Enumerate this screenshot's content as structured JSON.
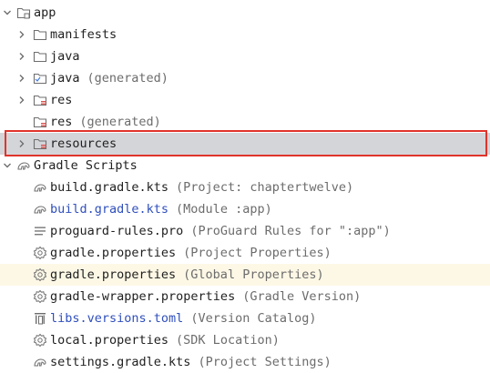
{
  "tree": {
    "app": {
      "label": "app",
      "icon": "module-folder-icon"
    },
    "manifests": {
      "label": "manifests",
      "icon": "folder-icon"
    },
    "java": {
      "label": "java",
      "icon": "folder-icon"
    },
    "java_generated": {
      "label": "java",
      "hint": "(generated)",
      "icon": "generated-source-folder-icon"
    },
    "res": {
      "label": "res",
      "icon": "resource-folder-icon"
    },
    "res_generated": {
      "label": "res",
      "hint": "(generated)",
      "icon": "resource-folder-icon"
    },
    "resources": {
      "label": "resources",
      "icon": "resource-folder-icon"
    },
    "gradle_scripts": {
      "label": "Gradle Scripts",
      "icon": "gradle-elephant-icon"
    },
    "files": [
      {
        "label": "build.gradle.kts",
        "hint": "(Project: chaptertwelve)",
        "icon": "gradle-file-icon",
        "color": "#1f1f1f"
      },
      {
        "label": "build.gradle.kts",
        "hint": "(Module :app)",
        "icon": "gradle-file-icon",
        "color": "#2f4fbd"
      },
      {
        "label": "proguard-rules.pro",
        "hint": "(ProGuard Rules for \":app\")",
        "icon": "text-file-icon",
        "color": "#1f1f1f"
      },
      {
        "label": "gradle.properties",
        "hint": "(Project Properties)",
        "icon": "gear-icon",
        "color": "#1f1f1f"
      },
      {
        "label": "gradle.properties",
        "hint": "(Global Properties)",
        "icon": "gear-icon",
        "color": "#1f1f1f"
      },
      {
        "label": "gradle-wrapper.properties",
        "hint": "(Gradle Version)",
        "icon": "gear-icon",
        "color": "#1f1f1f"
      },
      {
        "label": "libs.versions.toml",
        "hint": "(Version Catalog)",
        "icon": "toml-file-icon",
        "color": "#2f4fbd"
      },
      {
        "label": "local.properties",
        "hint": "(SDK Location)",
        "icon": "gear-icon",
        "color": "#1f1f1f"
      },
      {
        "label": "settings.gradle.kts",
        "hint": "(Project Settings)",
        "icon": "gradle-file-icon",
        "color": "#1f1f1f"
      }
    ]
  },
  "colors": {
    "selection_background": "#d4d5d9",
    "selection_outline": "#e0342b",
    "highlight_row": "#fdf8e6",
    "hint_text": "#6c6c6c",
    "link_blue": "#2f4fbd"
  }
}
